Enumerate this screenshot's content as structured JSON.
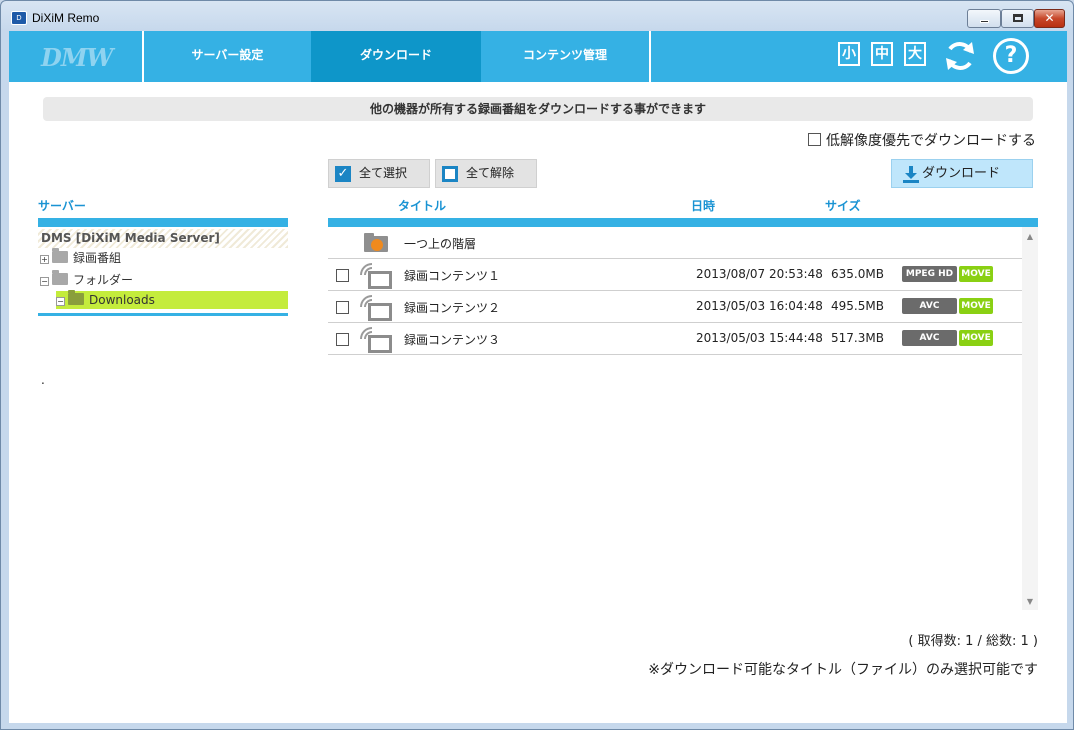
{
  "window": {
    "title": "DiXiM Remo",
    "app_icon_text": "D"
  },
  "nav": {
    "logo": "DMW",
    "tabs": [
      {
        "label": "サーバー設定"
      },
      {
        "label": "ダウンロード"
      },
      {
        "label": "コンテンツ管理"
      }
    ],
    "size_buttons": [
      "小",
      "中",
      "大"
    ],
    "help_glyph": "?"
  },
  "info_message": "他の機器が所有する録画番組をダウンロードする事ができます",
  "low_res_option": "低解像度優先でダウンロードする",
  "buttons": {
    "select_all": "全て選択",
    "deselect_all": "全て解除",
    "download": "ダウンロード"
  },
  "server_pane": {
    "header": "サーバー",
    "root": "DMS [DiXiM Media Server]",
    "items": [
      {
        "label": "録画番組",
        "expander": "+"
      },
      {
        "label": "フォルダー",
        "expander": "−"
      },
      {
        "label": "Downloads",
        "expander": "−"
      }
    ],
    "footer_text": "."
  },
  "table": {
    "columns": {
      "title": "タイトル",
      "date": "日時",
      "size": "サイズ"
    },
    "parent_row": "一つ上の階層",
    "rows": [
      {
        "title": "録画コンテンツ１",
        "date": "2013/08/07 20:53:48",
        "size": "635.0MB",
        "format": "MPEG HD",
        "move": "MOVE"
      },
      {
        "title": "録画コンテンツ２",
        "date": "2013/05/03 16:04:48",
        "size": "495.5MB",
        "format": "AVC",
        "move": "MOVE"
      },
      {
        "title": "録画コンテンツ３",
        "date": "2013/05/03 15:44:48",
        "size": "517.3MB",
        "format": "AVC",
        "move": "MOVE"
      }
    ]
  },
  "count_text": "( 取得数: 1 / 総数: 1 )",
  "footer_note": "※ダウンロード可能なタイトル（ファイル）のみ選択可能です",
  "colors": {
    "nav": "#35b1e4",
    "active_tab": "#0e96c9",
    "tree_selected": "#c4ec3c",
    "move_badge": "#8ad013"
  }
}
